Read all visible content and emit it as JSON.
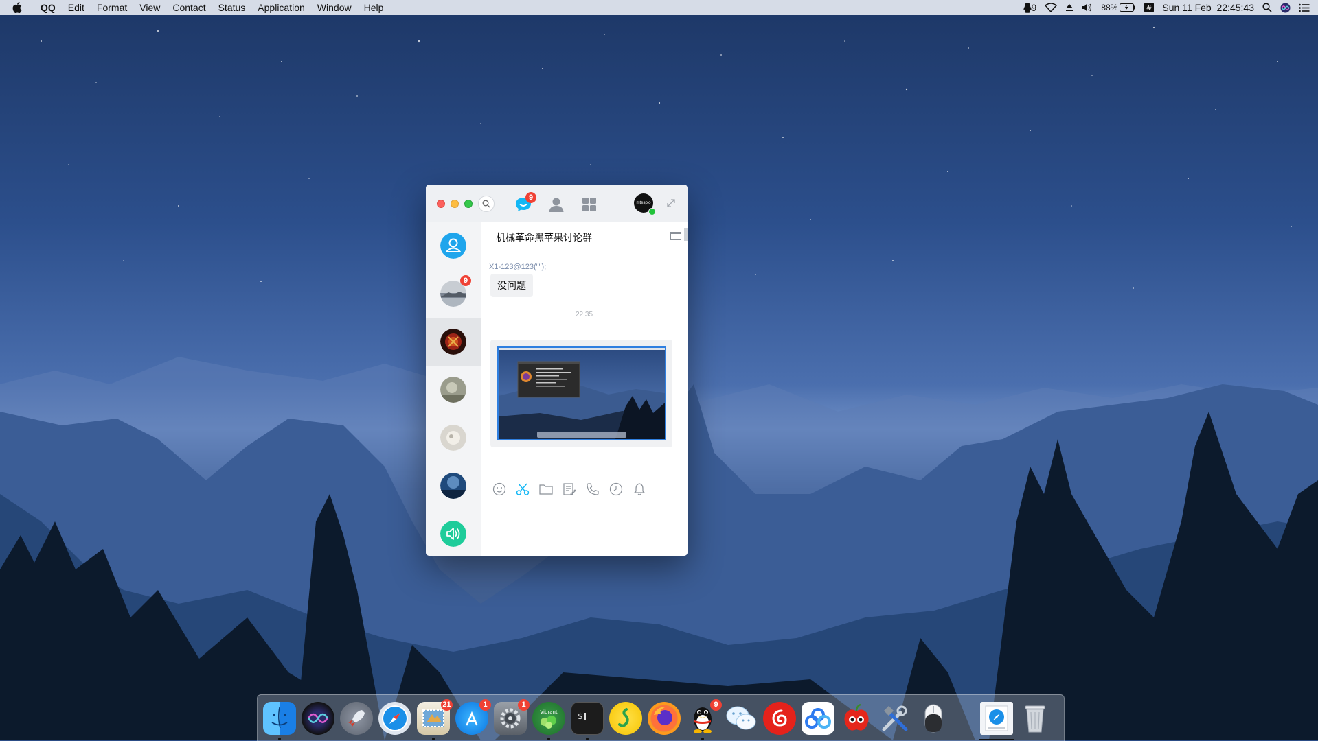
{
  "menubar": {
    "app_name": "QQ",
    "items": [
      "Edit",
      "Format",
      "View",
      "Contact",
      "Status",
      "Application",
      "Window",
      "Help"
    ],
    "status": {
      "qq_notifications": "9",
      "battery": "88%",
      "clock": "Sun 11 Feb  22:45:43"
    }
  },
  "qq_window": {
    "tabs": {
      "messages_badge": "9"
    },
    "profile_label": "mtesplo",
    "conversations": [
      {
        "name": "contacts-group",
        "badge": ""
      },
      {
        "name": "lake-avatar",
        "badge": "9"
      },
      {
        "name": "red-avatar",
        "badge": ""
      },
      {
        "name": "grey-avatar",
        "badge": ""
      },
      {
        "name": "light-avatar",
        "badge": ""
      },
      {
        "name": "blue-avatar",
        "badge": ""
      },
      {
        "name": "speaker-avatar",
        "badge": ""
      }
    ],
    "chat": {
      "title": "机械革命黑苹果讨论群",
      "sender": "X1-123@123(\"\");",
      "message": "没问题",
      "timestamp": "22:35"
    }
  },
  "dock": {
    "apps": [
      {
        "name": "Finder",
        "badge": ""
      },
      {
        "name": "Siri",
        "badge": ""
      },
      {
        "name": "Launchpad",
        "badge": ""
      },
      {
        "name": "Safari",
        "badge": ""
      },
      {
        "name": "Mail",
        "badge": "21"
      },
      {
        "name": "App Store",
        "badge": "1"
      },
      {
        "name": "System Preferences",
        "badge": "1"
      },
      {
        "name": "Vibrant",
        "badge": ""
      },
      {
        "name": "Terminal",
        "badge": ""
      },
      {
        "name": "QQ Music",
        "badge": ""
      },
      {
        "name": "Firefox",
        "badge": ""
      },
      {
        "name": "QQ",
        "badge": "9"
      },
      {
        "name": "WeChat",
        "badge": ""
      },
      {
        "name": "NetEase Music",
        "badge": ""
      },
      {
        "name": "Baidu Netdisk",
        "badge": ""
      },
      {
        "name": "Apple Tool",
        "badge": ""
      },
      {
        "name": "Utilities",
        "badge": ""
      },
      {
        "name": "Mouse",
        "badge": ""
      },
      {
        "name": "Downloads",
        "badge": ""
      },
      {
        "name": "Trash",
        "badge": ""
      }
    ]
  }
}
